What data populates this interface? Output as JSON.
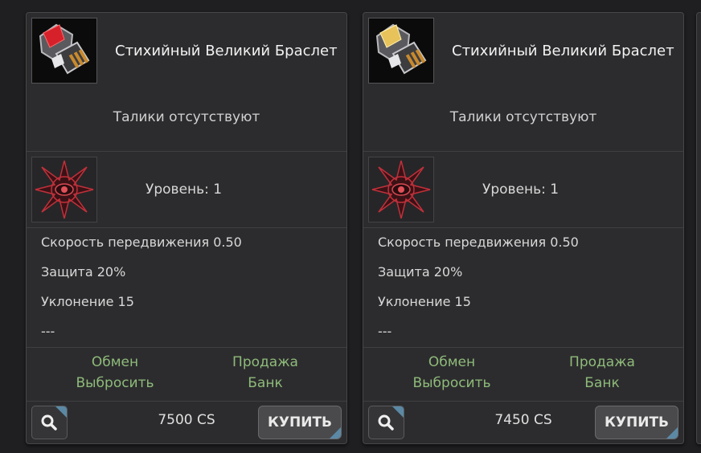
{
  "cards": [
    {
      "item_name": "Стихийный Великий Браслет",
      "talic_text": "Талики отсутствуют",
      "level_text": "Уровень: 1",
      "stats": [
        "Скорость передвижения 0.50",
        "Защита 20%",
        "Уклонение 15",
        "---"
      ],
      "actions": {
        "exchange": "Обмен",
        "sell": "Продажа",
        "drop": "Выбросить",
        "bank": "Банк"
      },
      "price": "7500 CS",
      "buy_label": "КУПИТЬ",
      "gem_color": "#d6202a"
    },
    {
      "item_name": "Стихийный Великий Браслет",
      "talic_text": "Талики отсутствуют",
      "level_text": "Уровень: 1",
      "stats": [
        "Скорость передвижения 0.50",
        "Защита 20%",
        "Уклонение 15",
        "---"
      ],
      "actions": {
        "exchange": "Обмен",
        "sell": "Продажа",
        "drop": "Выбросить",
        "bank": "Банк"
      },
      "price": "7450 CS",
      "buy_label": "КУПИТЬ",
      "gem_color": "#e8c25a"
    }
  ],
  "icons": {
    "item": "bracelet-icon",
    "level": "rune-star-icon",
    "search": "search-icon"
  },
  "colors": {
    "action_green": "#8fbb7a",
    "accent_blue": "#5b89a5",
    "card_bg": "#2c2c2e"
  }
}
